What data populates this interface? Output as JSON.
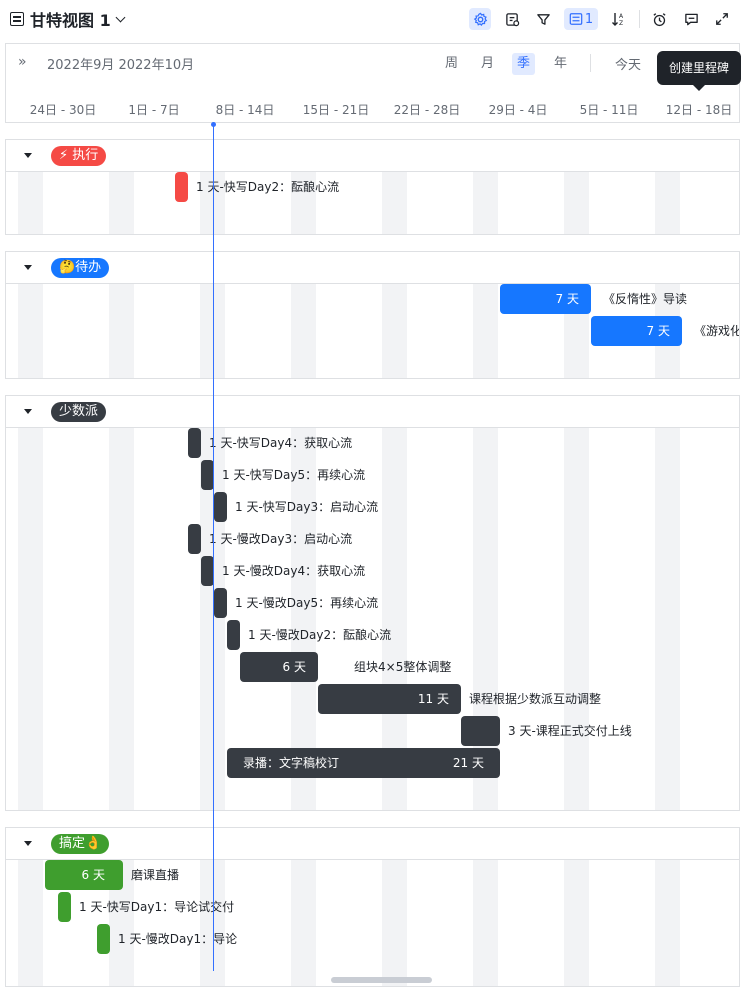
{
  "toolbar": {
    "title": "甘特视图 1",
    "filter_count": "1",
    "icons": [
      "settings-icon",
      "field-config-icon",
      "filter-icon",
      "group-icon",
      "sort-icon",
      "alarm-icon",
      "comment-icon",
      "expand-icon"
    ]
  },
  "header": {
    "months": "2022年9月 2022年10月",
    "scales": [
      "周",
      "月",
      "季",
      "年"
    ],
    "active_scale": "季",
    "today": "今天",
    "weeks": [
      "24日 - 30日",
      "1日 - 7日",
      "8日 - 14日",
      "15日 - 21日",
      "22日 - 28日",
      "29日 - 4日",
      "5日 - 11日",
      "12日 - 18日"
    ]
  },
  "tooltip": "创建里程碑",
  "groups": [
    {
      "tag": "⚡ 执行",
      "color": "#f54a45",
      "tasks": [
        {
          "label": "1 天-快写Day2：酝酿心流"
        }
      ]
    },
    {
      "tag": "🤔待办",
      "color": "#1677ff",
      "tasks": [
        {
          "duration": "7 天",
          "label": "《反惰性》导读"
        },
        {
          "duration": "7 天",
          "label": "《游戏化"
        }
      ]
    },
    {
      "tag": "少数派",
      "color": "#373c43",
      "tasks": [
        {
          "label": "1 天-快写Day4：获取心流"
        },
        {
          "label": "1 天-快写Day5：再续心流"
        },
        {
          "label": "1 天-快写Day3：启动心流"
        },
        {
          "label": "1 天-慢改Day3：启动心流"
        },
        {
          "label": "1 天-慢改Day4：获取心流"
        },
        {
          "label": "1 天-慢改Day5：再续心流"
        },
        {
          "label": "1 天-慢改Day2：酝酿心流"
        },
        {
          "duration": "6 天",
          "label": "组块4×5整体调整"
        },
        {
          "duration": "11 天",
          "label": "课程根据少数派互动调整"
        },
        {
          "label": "3 天-课程正式交付上线"
        },
        {
          "inner": "录播：文字稿校订",
          "duration": "21 天"
        }
      ]
    },
    {
      "tag": "搞定👌",
      "color": "#3f9e2e",
      "tasks": [
        {
          "duration": "6 天",
          "label": "磨课直播"
        },
        {
          "label": "1 天-快写Day1：导论试交付"
        },
        {
          "label": "1 天-慢改Day1：导论"
        }
      ]
    }
  ]
}
